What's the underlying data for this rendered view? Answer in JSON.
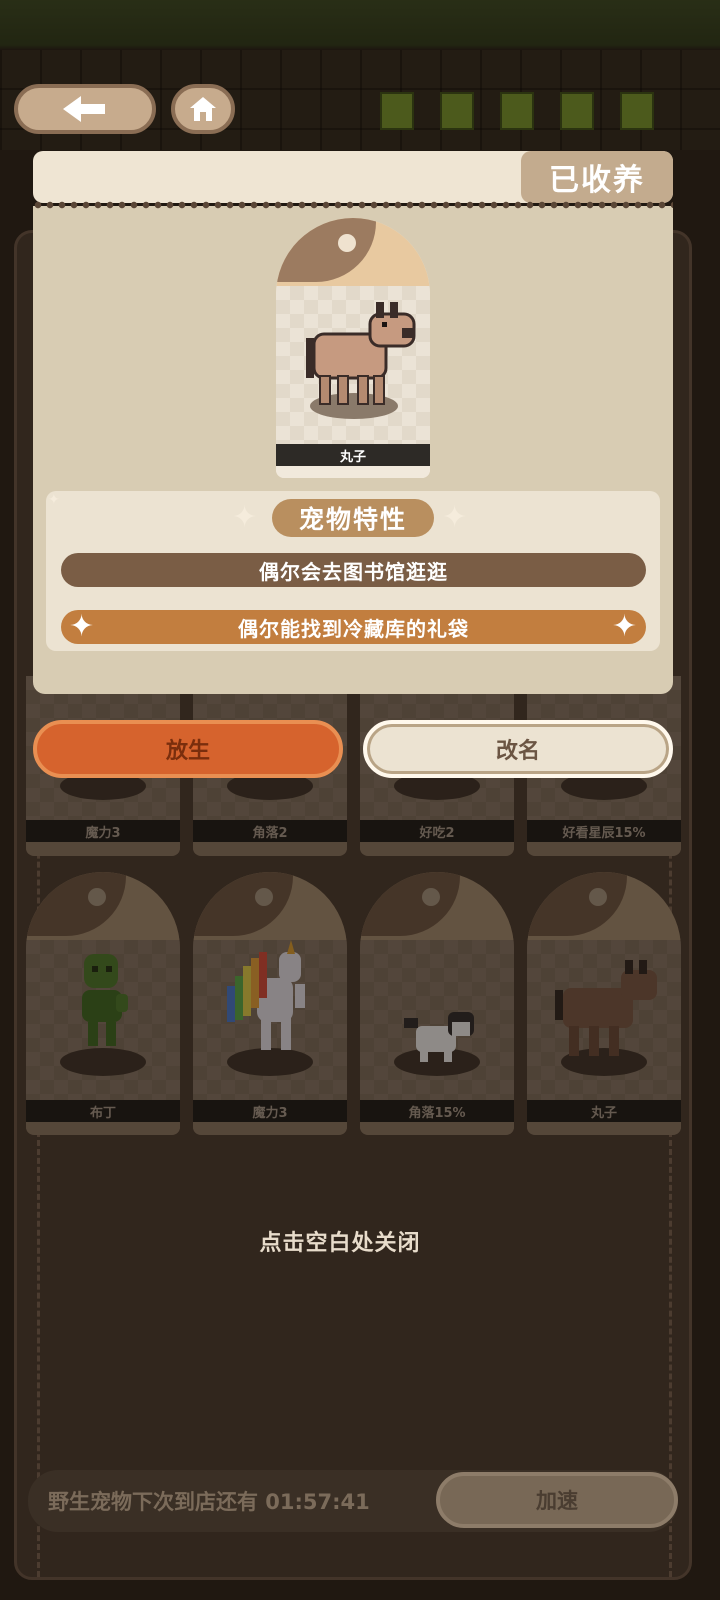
{
  "header": {
    "back_icon": "arrow-left-icon",
    "home_icon": "home-icon",
    "status_tab": "已收养"
  },
  "detail": {
    "pet_name": "丸子",
    "traits_title": "宠物特性",
    "traits": [
      "偶尔会去图书馆逛逛",
      "偶尔能找到冷藏库的礼袋"
    ]
  },
  "actions": {
    "release_label": "放生",
    "rename_label": "改名"
  },
  "grid": {
    "row1": [
      {
        "name": "魔力3"
      },
      {
        "name": "角落2"
      },
      {
        "name": "好吃2"
      },
      {
        "name": "好看星辰15%"
      }
    ],
    "row2": [
      {
        "name": "布丁"
      },
      {
        "name": "魔力3"
      },
      {
        "name": "角落15%"
      },
      {
        "name": "丸子"
      }
    ]
  },
  "close_hint": "点击空白处关闭",
  "footer": {
    "wild_timer": "野生宠物下次到店还有 01:57:41",
    "speed_label": "加速"
  },
  "colors": {
    "release": "#d6632d",
    "trait_primary": "#7a5d45",
    "trait_highlight": "#c27e3f",
    "title_badge": "#b98f5f"
  }
}
